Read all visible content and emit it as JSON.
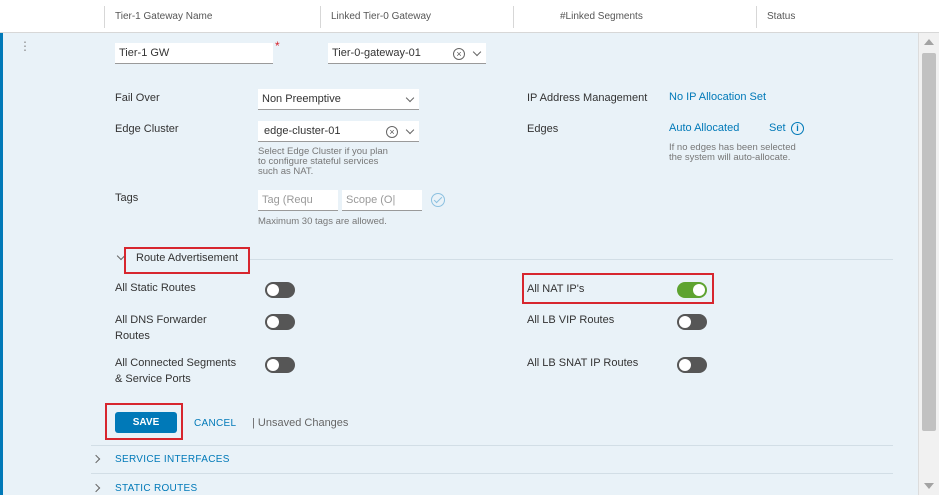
{
  "table_header": {
    "col_name": "Tier-1 Gateway Name",
    "col_linked_t0": "Linked Tier-0 Gateway",
    "col_segments": "#Linked Segments",
    "col_status": "Status"
  },
  "row_menu": "⋮",
  "form": {
    "name_value": "Tier-1 GW",
    "required_mark": "*",
    "tier0_value": "Tier-0-gateway-01",
    "failover_label": "Fail Over",
    "failover_value": "Non Preemptive",
    "edge_cluster_label": "Edge Cluster",
    "edge_cluster_value": "edge-cluster-01",
    "edge_cluster_help": [
      "Select Edge Cluster if you plan",
      "to configure stateful services",
      "such as NAT."
    ],
    "tags_label": "Tags",
    "tag_placeholder": "Tag (Requ",
    "scope_placeholder": "Scope (O|",
    "tags_help": "Maximum 30 tags are allowed.",
    "ip_mgmt_label": "IP Address Management",
    "ip_mgmt_value": "No IP Allocation Set",
    "edges_label": "Edges",
    "edges_value": "Auto Allocated",
    "edges_set": "Set",
    "edges_help": [
      "If no edges has been selected",
      "the system will auto-allocate."
    ]
  },
  "route_advertisement": {
    "title": "Route Advertisement",
    "left": [
      {
        "label": [
          "All Static Routes"
        ],
        "on": false
      },
      {
        "label": [
          "All DNS Forwarder",
          "Routes"
        ],
        "on": false
      },
      {
        "label": [
          "All Connected Segments",
          "& Service Ports"
        ],
        "on": false
      }
    ],
    "right": [
      {
        "label": [
          "All NAT IP's"
        ],
        "on": true
      },
      {
        "label": [
          "All LB VIP Routes"
        ],
        "on": false
      },
      {
        "label": [
          "All LB SNAT IP Routes"
        ],
        "on": false
      }
    ]
  },
  "actions": {
    "save": "SAVE",
    "cancel": "CANCEL",
    "unsaved": "| Unsaved Changes"
  },
  "sections": {
    "service_interfaces": "SERVICE INTERFACES",
    "static_routes": "STATIC ROUTES"
  },
  "colors": {
    "accent": "#0079b8",
    "panel_bg": "#e9f2f8",
    "toggle_on": "#5ea330",
    "toggle_off": "#565656",
    "highlight": "#d7262e"
  }
}
